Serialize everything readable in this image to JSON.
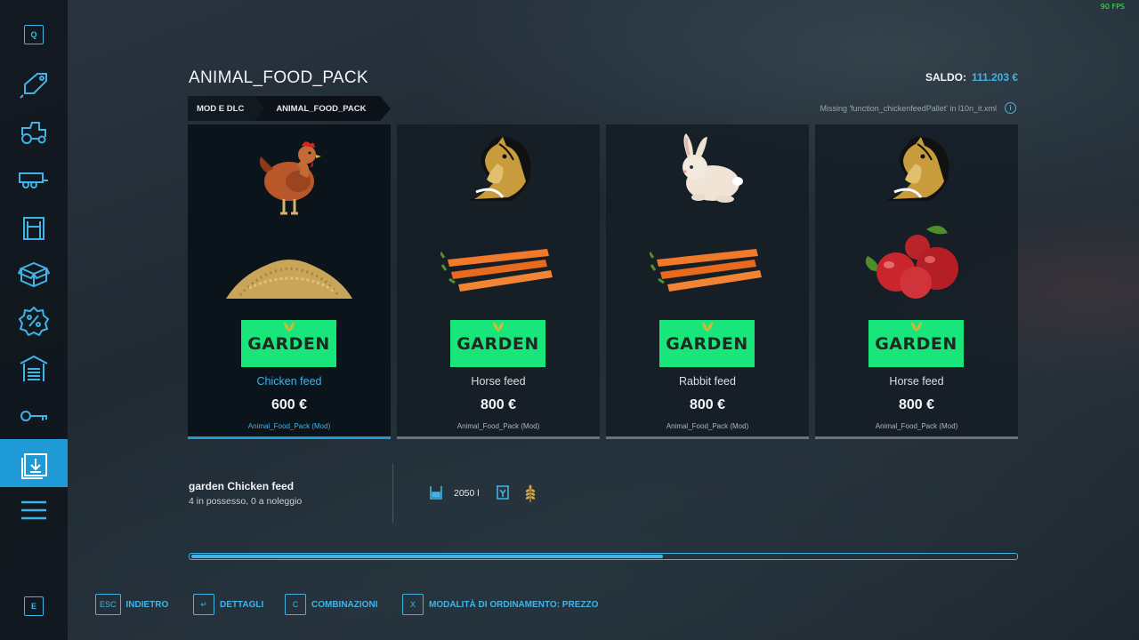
{
  "fps": "90 FPS",
  "sidebar": {
    "top_key": "Q",
    "bottom_key": "E",
    "items": [
      {
        "icon": "price-tag-icon"
      },
      {
        "icon": "tractor-icon"
      },
      {
        "icon": "trailer-icon"
      },
      {
        "icon": "silo-icon"
      },
      {
        "icon": "box-icon"
      },
      {
        "icon": "discount-icon"
      },
      {
        "icon": "garage-icon"
      },
      {
        "icon": "key-icon"
      },
      {
        "icon": "mods-download-icon",
        "active": true
      },
      {
        "icon": "menu-icon"
      }
    ]
  },
  "header": {
    "title": "ANIMAL_FOOD_PACK",
    "balance_label": "SALDO:",
    "balance_value": "111.203 €"
  },
  "breadcrumb": [
    "MOD E DLC",
    "ANIMAL_FOOD_PACK"
  ],
  "warning": "Missing 'function_chickenfeedPallet' in l10n_it.xml",
  "cards": [
    {
      "name": "Chicken feed",
      "price": "600 €",
      "source": "Animal_Food_Pack (Mod)",
      "brand": "GARDEN",
      "animal": "chicken",
      "food": "grain",
      "selected": true
    },
    {
      "name": "Horse feed",
      "price": "800 €",
      "source": "Animal_Food_Pack (Mod)",
      "brand": "GARDEN",
      "animal": "horse",
      "food": "carrots"
    },
    {
      "name": "Rabbit feed",
      "price": "800 €",
      "source": "Animal_Food_Pack (Mod)",
      "brand": "GARDEN",
      "animal": "rabbit",
      "food": "carrots"
    },
    {
      "name": "Horse feed",
      "price": "800 €",
      "source": "Animal_Food_Pack (Mod)",
      "brand": "GARDEN",
      "animal": "horse",
      "food": "apples"
    }
  ],
  "details": {
    "name": "garden Chicken feed",
    "ownership": "4 in possesso, 0 a noleggio",
    "capacity": "2050 l"
  },
  "scroll": {
    "fraction": 0.57
  },
  "hints": [
    {
      "key": "ESC",
      "label": "INDIETRO"
    },
    {
      "key": "↵",
      "label": "DETTAGLI"
    },
    {
      "key": "C",
      "label": "COMBINAZIONI"
    },
    {
      "key": "X",
      "label": "MODALITÀ DI ORDINAMENTO: PREZZO"
    }
  ],
  "colors": {
    "accent": "#3fb4e8",
    "active": "#1e9bd7",
    "brand": "#19e67a"
  }
}
